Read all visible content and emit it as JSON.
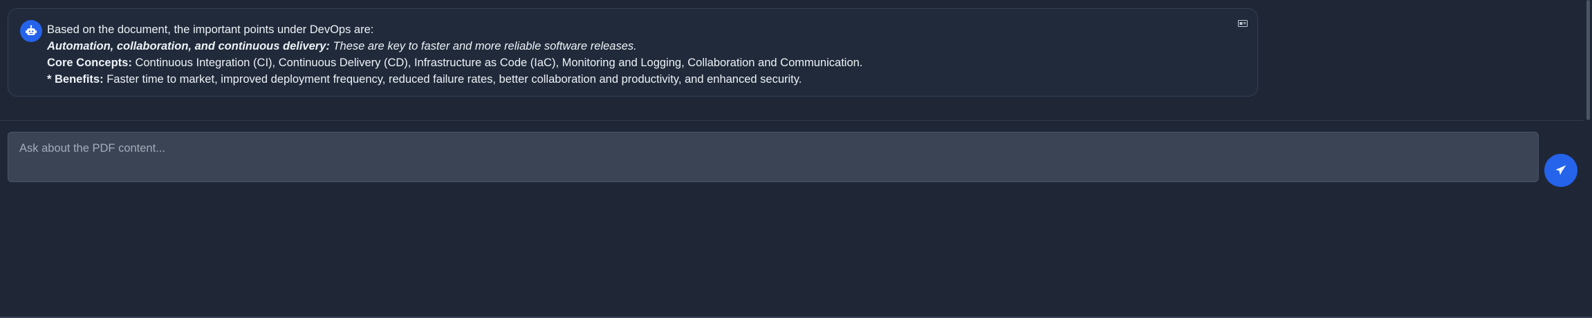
{
  "message": {
    "intro": "Based on the document, the important points under DevOps are:",
    "highlight_bold": "Automation, collaboration, and continuous delivery:",
    "highlight_text": " These are key to faster and more reliable software releases.",
    "core_label": "Core Concepts:",
    "core_text": " Continuous Integration (CI), Continuous Delivery (CD), Infrastructure as Code (IaC), Monitoring and Logging, Collaboration and Communication.",
    "benefits_label": "* Benefits:",
    "benefits_text": " Faster time to market, improved deployment frequency, reduced failure rates, better collaboration and productivity, and enhanced security."
  },
  "composer": {
    "placeholder": "Ask about the PDF content...",
    "value": ""
  },
  "icons": {
    "avatar": "robot-icon",
    "copy": "copy-icon",
    "send": "paper-plane-icon"
  },
  "colors": {
    "background": "#1f2737",
    "accent": "#2563eb",
    "input_background": "#3a4455"
  }
}
